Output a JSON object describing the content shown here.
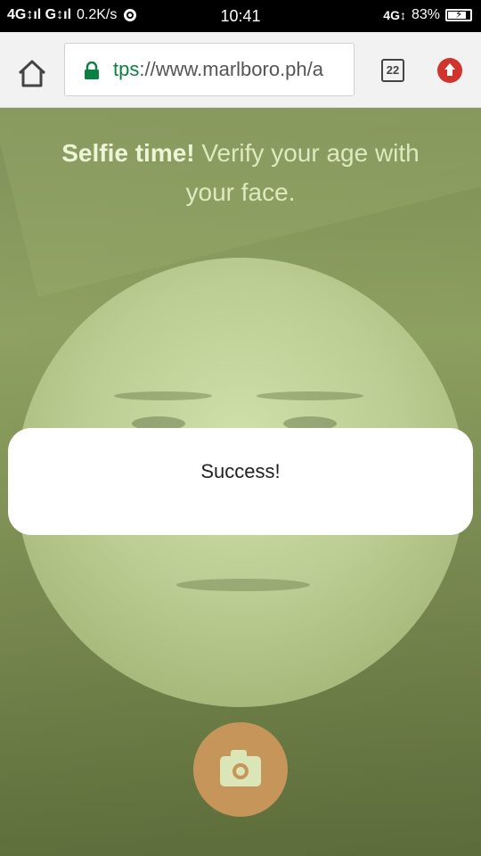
{
  "status_bar": {
    "network_left": "4G↕ıl G↕ıl",
    "net_speed": "0.2K/s",
    "time": "10:41",
    "network_right": "4G↕",
    "battery_percent": "83%",
    "battery_level": 0.83
  },
  "browser": {
    "url_scheme_fragment": "tps",
    "url_rest": "://www.marlboro.ph/a",
    "tab_count": "22"
  },
  "page": {
    "prompt_bold": "Selfie time!",
    "prompt_rest": " Verify your age with your face.",
    "success_message": "Success!"
  },
  "colors": {
    "overlay_tint": "#7a8b50",
    "shutter": "#c6955a",
    "url_scheme": "#0b8043",
    "update_badge": "#d0342c"
  },
  "icons": {
    "home": "home-icon",
    "lock": "lock-icon",
    "tabs": "tabs-icon",
    "update": "update-icon",
    "camera": "camera-icon"
  }
}
